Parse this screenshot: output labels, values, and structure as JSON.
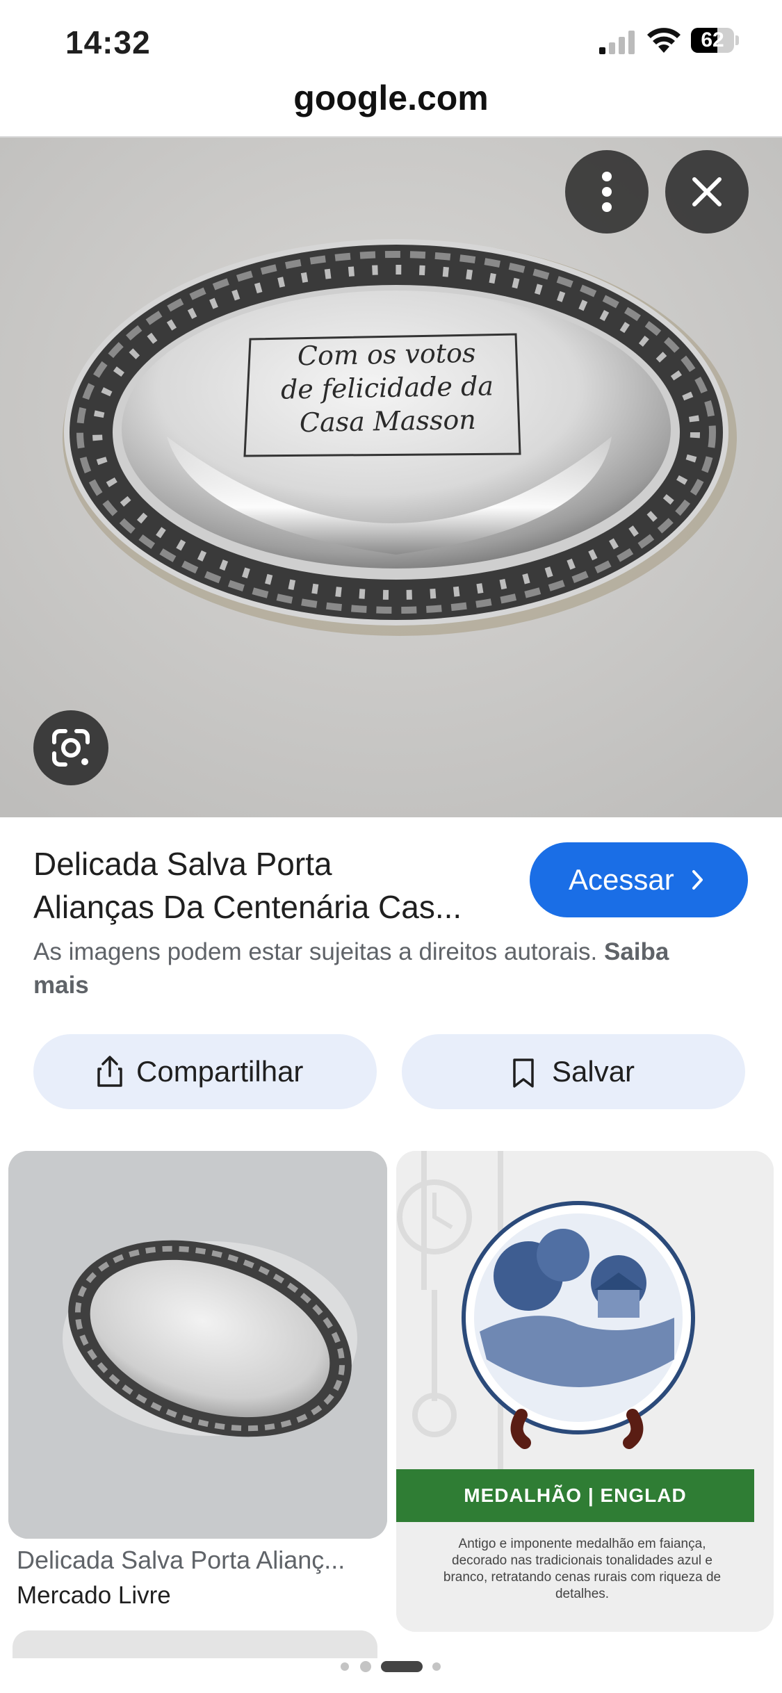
{
  "status_bar": {
    "time": "14:32",
    "battery": "62",
    "battery_level": 0.62
  },
  "browser": {
    "url": "google.com"
  },
  "image": {
    "engraving_lines": [
      "Com os votos",
      "de felicidade da",
      "Casa Masson"
    ]
  },
  "result": {
    "title_line1": "Delicada Salva Porta",
    "title_line2": "Alianças Da Centenária Cas...",
    "visit_label": "Acessar",
    "copyright_text": "As imagens podem estar sujeitas a direitos autorais.",
    "learn_more": "Saiba mais"
  },
  "actions": {
    "share_label": "Compartilhar",
    "save_label": "Salvar"
  },
  "related": [
    {
      "title": "Delicada Salva Porta Alianç...",
      "source": "Mercado Livre"
    },
    {
      "banner": "MEDALHÃO | ENGLAD",
      "description": "Antigo e imponente medalhão em faiança, decorado nas tradicionais tonalidades azul e branco, retratando cenas rurais com riqueza de detalhes."
    }
  ],
  "pagination": {
    "current": 3,
    "total": 4
  },
  "colors": {
    "accent": "#1a6ee6",
    "chip_bg": "#e8eefa",
    "banner_green": "#2f7d34"
  }
}
